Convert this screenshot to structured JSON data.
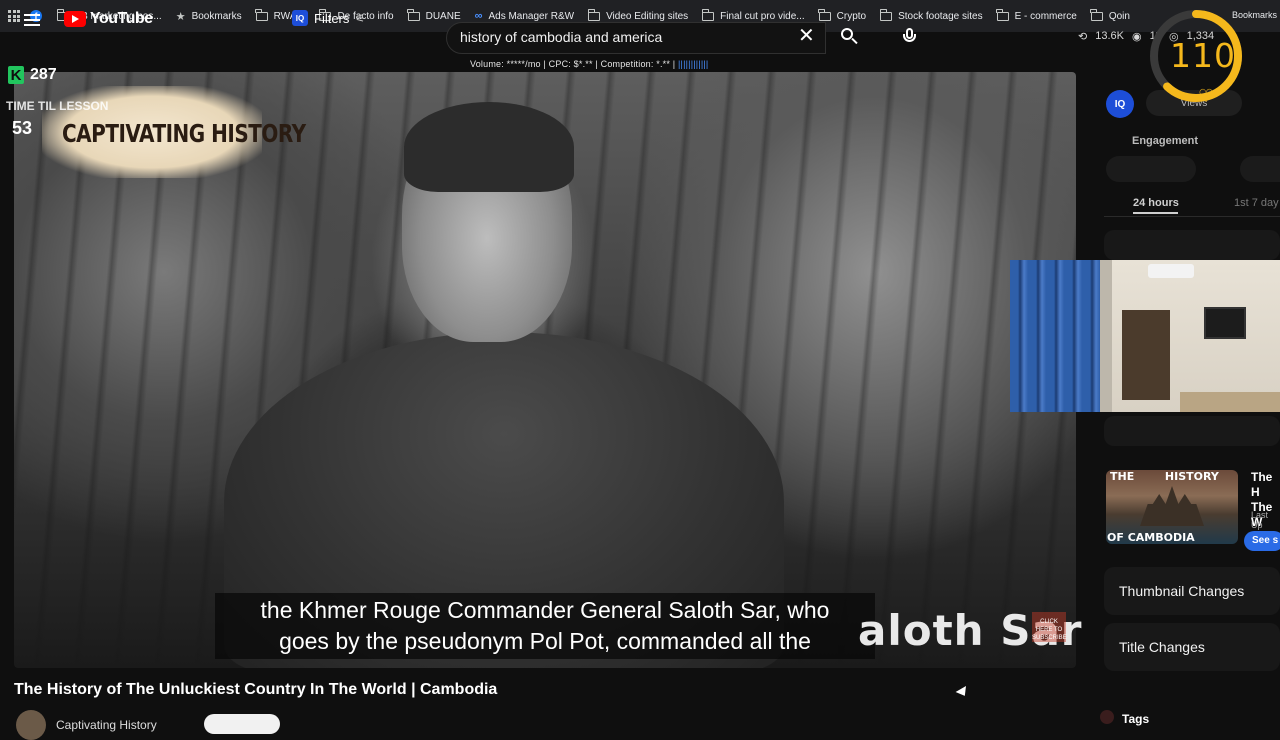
{
  "bookmarks": {
    "items": [
      {
        "label": "FB marketing pos...",
        "icon": "facebook-icon"
      },
      {
        "label": "Bookmarks",
        "icon": "star-icon"
      },
      {
        "label": "RWAW",
        "icon": "folder-icon"
      },
      {
        "label": "De facto info",
        "icon": "folder-icon"
      },
      {
        "label": "DUANE",
        "icon": "folder-icon"
      },
      {
        "label": "Ads Manager R&W",
        "icon": "meta-icon"
      },
      {
        "label": "Video Editing sites",
        "icon": "folder-icon"
      },
      {
        "label": "Final cut pro vide...",
        "icon": "folder-icon"
      },
      {
        "label": "Crypto",
        "icon": "folder-icon"
      },
      {
        "label": "Stock footage sites",
        "icon": "folder-icon"
      },
      {
        "label": "E - commerce",
        "icon": "folder-icon"
      },
      {
        "label": "Qoin",
        "icon": "folder-icon"
      }
    ],
    "right_label": "Bookmarks"
  },
  "header": {
    "logo_text": "YouTube",
    "filters_label": "Filters",
    "search_query": "history of cambodia and america",
    "keyword_stats": "Volume: *****/mo | CPC: $*.** | Competition: *.** |",
    "keyword_bars": "||||||||||||",
    "top_stats": {
      "views": "13.6K",
      "eye": "11",
      "watching": "1,334"
    }
  },
  "overlays": {
    "k_score": "287",
    "timer_label": "TIME TIL LESSON",
    "timer_value": "53",
    "channel_logo_text": "CAPTIVATING HISTORY",
    "gauge_value": "110",
    "gauge_fill": 0.62,
    "gauge_color": "#f5b81c"
  },
  "video": {
    "subtitle_line1": "the Khmer Rouge Commander General Saloth Sar, who",
    "subtitle_line2": "goes by the pseudonym Pol Pot, commanded all the",
    "name_overlay": "aloth Sar",
    "mini_subscribe": "CLICK HERE TO SUBSCRIBE",
    "title": "The History of The Unluckiest Country In The World | Cambodia",
    "channel_name": "Captivating History"
  },
  "panel": {
    "iq_label": "IQ",
    "views_tab": "Views",
    "engagement_label": "Engagement",
    "timeframe_active": "24 hours",
    "timeframe_other": "1st 7 day",
    "related": {
      "thumb_top_a": "THE",
      "thumb_top_b": "HISTORY",
      "thumb_bottom": "OF CAMBODIA",
      "title_line1": "The H",
      "title_line2": "The W",
      "last_updated": "Last Up",
      "see_button": "See s"
    },
    "thumbnail_changes": "Thumbnail Changes",
    "title_changes": "Title Changes",
    "tags_label": "Tags"
  },
  "colors": {
    "accent_blue": "#1d4ed8",
    "youtube_red": "#ff0000",
    "k_green": "#22c55e"
  }
}
